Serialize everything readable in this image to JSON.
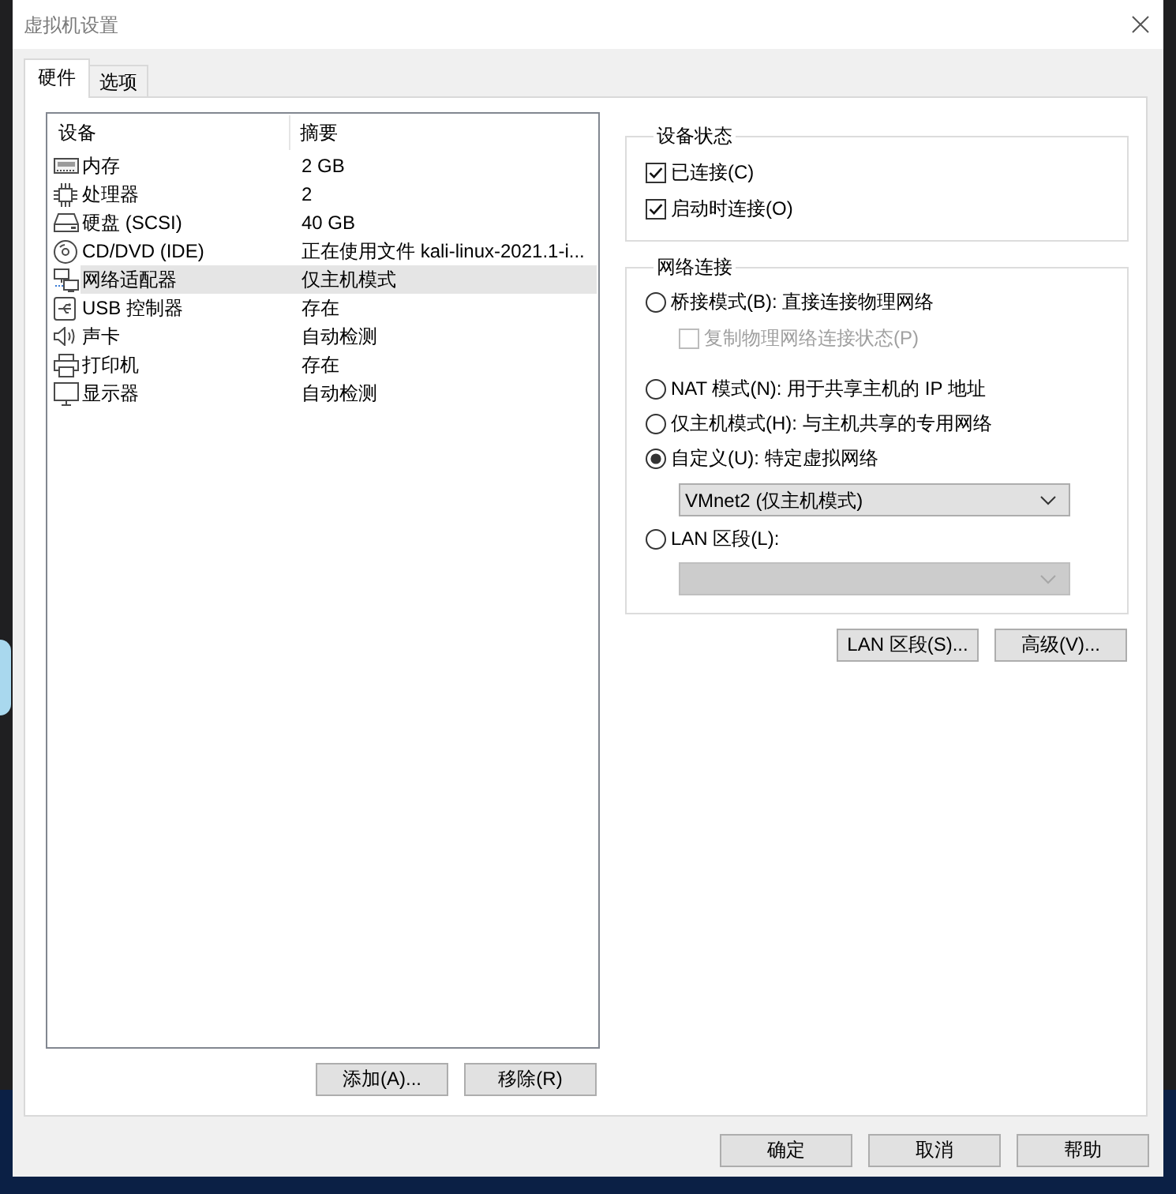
{
  "window": {
    "title": "虚拟机设置"
  },
  "tabs": [
    {
      "label": "硬件",
      "selected": true
    },
    {
      "label": "选项",
      "selected": false
    }
  ],
  "device_list": {
    "columns": [
      "设备",
      "摘要"
    ],
    "rows": [
      {
        "kind": "memory",
        "device": "内存",
        "summary": "2 GB",
        "selected": false
      },
      {
        "kind": "processor",
        "device": "处理器",
        "summary": "2",
        "selected": false
      },
      {
        "kind": "hard_disk",
        "device": "硬盘 (SCSI)",
        "summary": "40 GB",
        "selected": false
      },
      {
        "kind": "cd_dvd",
        "device": "CD/DVD (IDE)",
        "summary": "正在使用文件 kali-linux-2021.1-i...",
        "selected": false
      },
      {
        "kind": "network",
        "device": "网络适配器",
        "summary": "仅主机模式",
        "selected": true
      },
      {
        "kind": "usb",
        "device": "USB 控制器",
        "summary": "存在",
        "selected": false
      },
      {
        "kind": "sound",
        "device": "声卡",
        "summary": "自动检测",
        "selected": false
      },
      {
        "kind": "printer",
        "device": "打印机",
        "summary": "存在",
        "selected": false
      },
      {
        "kind": "display",
        "device": "显示器",
        "summary": "自动检测",
        "selected": false
      }
    ]
  },
  "list_buttons": [
    "添加(A)...",
    "移除(R)"
  ],
  "device_status": {
    "title": "设备状态",
    "options": [
      {
        "label": "已连接(C)",
        "checked": true
      },
      {
        "label": "启动时连接(O)",
        "checked": true
      }
    ]
  },
  "network_connection": {
    "title": "网络连接",
    "items": [
      {
        "kind": "radio",
        "label": "桥接模式(B): 直接连接物理网络",
        "selected": false,
        "disabled": false
      },
      {
        "kind": "checkbox",
        "label": "复制物理网络连接状态(P)",
        "checked": false,
        "disabled": true
      },
      {
        "kind": "radio",
        "label": "NAT 模式(N): 用于共享主机的 IP 地址",
        "selected": false,
        "disabled": false
      },
      {
        "kind": "radio",
        "label": "仅主机模式(H): 与主机共享的专用网络",
        "selected": false,
        "disabled": false
      },
      {
        "kind": "radio",
        "label": "自定义(U): 特定虚拟网络",
        "selected": true,
        "disabled": false
      },
      {
        "kind": "select",
        "value": "VMnet2 (仅主机模式)",
        "disabled": false
      },
      {
        "kind": "radio",
        "label": "LAN 区段(L):",
        "selected": false,
        "disabled": false
      },
      {
        "kind": "select",
        "disabled": true
      }
    ]
  },
  "network_buttons": [
    "LAN 区段(S)...",
    "高级(V)..."
  ],
  "dialog_buttons": [
    "确定",
    "取消",
    "帮助"
  ]
}
